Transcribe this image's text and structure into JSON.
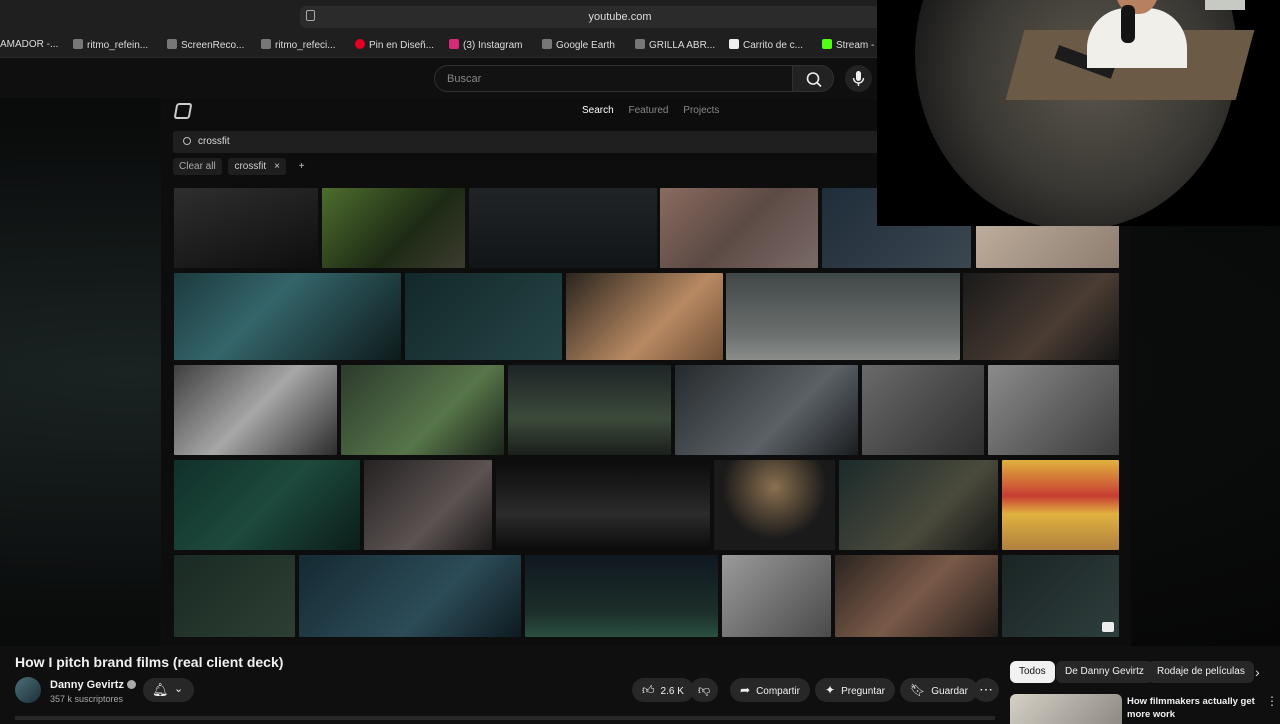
{
  "browser": {
    "url": "youtube.com",
    "bookmarks": [
      "AMADOR -...",
      "ritmo_refein...",
      "ScreenReco...",
      "ritmo_refeci...",
      "Pin en Diseñ...",
      "(3) Instagram",
      "Google Earth",
      "GRILLA ABR...",
      "Carrito de c...",
      "Stream - K"
    ]
  },
  "youtube": {
    "search_placeholder": "Buscar"
  },
  "video_content": {
    "tabs": [
      "Search",
      "Featured",
      "Projects"
    ],
    "search_value": "crossfit",
    "clear_all": "Clear all",
    "tag": "crossfit",
    "tag_remove": "×",
    "add": "+"
  },
  "video": {
    "title": "How I pitch brand films (real client deck)",
    "channel": "Danny Gevirtz",
    "subscribers": "357 k suscriptores",
    "likes": "2.6 K",
    "share": "Compartir",
    "ask": "Preguntar",
    "save": "Guardar",
    "more": "⋯"
  },
  "sidebar": {
    "filters": [
      "Todos",
      "De Danny Gevirtz",
      "Rodaje de películas"
    ],
    "related_title": "How filmmakers actually get more work"
  },
  "colors": {
    "background": "#0f0f0f",
    "chip_active": "#f1f1f1",
    "button_bg": "#272727"
  }
}
